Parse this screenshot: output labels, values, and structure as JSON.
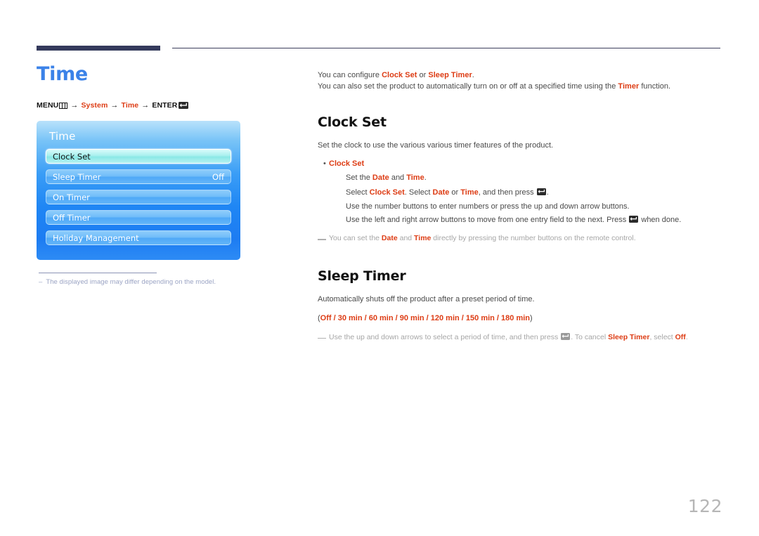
{
  "page": {
    "title": "Time",
    "number": "122"
  },
  "breadcrumb": {
    "menu_label": "MENU",
    "menu_icon": "menu-bars-icon",
    "arrow": "→",
    "item1": "System",
    "item2": "Time",
    "enter_label": "ENTER",
    "enter_icon": "enter-return-icon"
  },
  "osd": {
    "title": "Time",
    "rows": [
      {
        "label": "Clock Set",
        "value": "",
        "selected": true
      },
      {
        "label": "Sleep Timer",
        "value": "Off",
        "selected": false
      },
      {
        "label": "On Timer",
        "value": "",
        "selected": false
      },
      {
        "label": "Off Timer",
        "value": "",
        "selected": false
      },
      {
        "label": "Holiday Management",
        "value": "",
        "selected": false
      }
    ],
    "figure_note": {
      "dash": "–",
      "text": "The displayed image may differ depending on the model."
    }
  },
  "intro": {
    "line1_a": "You can configure ",
    "line1_b": "Clock Set",
    "line1_c": " or ",
    "line1_d": "Sleep Timer",
    "line1_e": ".",
    "line2_a": "You can also set the product to automatically turn on or off at a specified time using the ",
    "line2_b": "Timer",
    "line2_c": " function."
  },
  "clock_set": {
    "heading": "Clock Set",
    "intro": "Set the clock to use the various various timer features of the product.",
    "bullet": {
      "dot": "•",
      "title": "Clock Set",
      "line1_a": "Set the ",
      "line1_b": "Date",
      "line1_c": " and ",
      "line1_d": "Time",
      "line1_e": ".",
      "line2_a": "Select ",
      "line2_b": "Clock Set",
      "line2_c": ". Select ",
      "line2_d": "Date",
      "line2_e": " or ",
      "line2_f": "Time",
      "line2_g": ", and then press ",
      "line2_h": ".",
      "line3": "Use the number buttons to enter numbers or press the up and down arrow buttons.",
      "line4_a": "Use the left and right arrow buttons to move from one entry field to the next. Press ",
      "line4_b": " when done."
    },
    "note": {
      "a": "You can set the ",
      "b": "Date",
      "c": " and ",
      "d": "Time",
      "e": " directly by pressing the number buttons on the remote control."
    }
  },
  "sleep_timer": {
    "heading": "Sleep Timer",
    "intro": "Automatically shuts off the product after a preset period of time.",
    "options_open": "(",
    "options": "Off / 30 min / 60 min / 90 min / 120 min / 150 min / 180 min",
    "options_close": ")",
    "note": {
      "a": "Use the up and down arrows to select a period of time, and then press ",
      "b": ". To cancel ",
      "c": "Sleep Timer",
      "d": ", select ",
      "e": "Off",
      "f": "."
    }
  },
  "colors": {
    "title_blue": "#3b82e8",
    "accent_red": "#dd3c14",
    "rule_navy": "#343a5c",
    "note_gray": "#a6a6a6",
    "page_num_gray": "#b6b6b6"
  }
}
